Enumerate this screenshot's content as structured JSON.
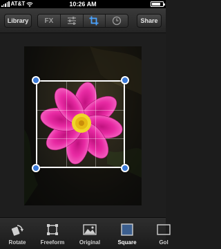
{
  "status_bar": {
    "carrier": "AT&T",
    "time": "10:26 AM",
    "battery_percent": 80
  },
  "toolbar": {
    "library_label": "Library",
    "share_label": "Share",
    "segments": [
      {
        "label": "FX",
        "icon": "fx-text"
      },
      {
        "label": "",
        "icon": "sliders-icon"
      },
      {
        "label": "",
        "icon": "crop-icon"
      },
      {
        "label": "",
        "icon": "clock-icon"
      }
    ],
    "active_segment": 2
  },
  "colors": {
    "handle": "#3b7ad8",
    "accent": "#ffffff",
    "flower": "#e21f9c",
    "flower_center": "#f0d62a"
  },
  "bottom_bar": {
    "tools": [
      {
        "label": "Rotate",
        "icon": "rotate-icon"
      },
      {
        "label": "Freeform",
        "icon": "freeform-icon"
      },
      {
        "label": "Original",
        "icon": "original-photo-icon"
      },
      {
        "label": "Square",
        "icon": "square-icon"
      },
      {
        "label": "Gol",
        "icon": "golden-ratio-icon"
      }
    ],
    "selected_tool": 3
  }
}
